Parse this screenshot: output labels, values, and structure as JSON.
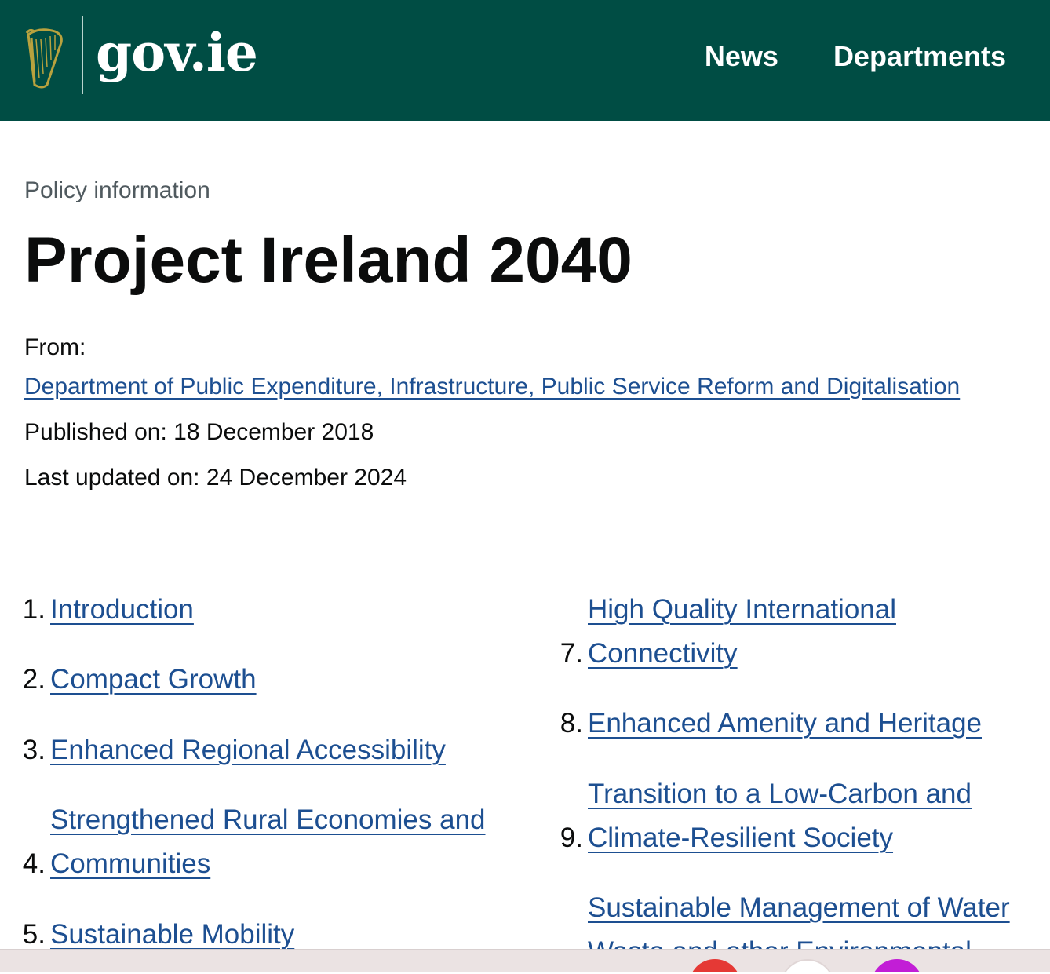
{
  "header": {
    "logo_text": "gov.ie",
    "nav": [
      "News",
      "Departments"
    ],
    "colors": {
      "background": "#004d44",
      "text": "#ffffff"
    }
  },
  "page": {
    "eyebrow": "Policy information",
    "title": "Project Ireland 2040",
    "from_label": "From:",
    "department": "Department of Public Expenditure, Infrastructure, Public Service Reform and Digitalisation",
    "published": "Published on: 18 December 2018",
    "updated": "Last updated on: 24 December 2024"
  },
  "toc": [
    {
      "num": "1.",
      "lines": [
        "Introduction"
      ]
    },
    {
      "num": "2.",
      "lines": [
        "Compact Growth"
      ]
    },
    {
      "num": "3.",
      "lines": [
        "Enhanced Regional Accessibility"
      ]
    },
    {
      "num": "4.",
      "lines": [
        "Strengthened Rural Economies and",
        "Communities"
      ]
    },
    {
      "num": "5.",
      "lines": [
        "Sustainable Mobility"
      ]
    },
    {
      "num": "7.",
      "lines": [
        "High Quality International",
        "Connectivity"
      ]
    },
    {
      "num": "8.",
      "lines": [
        "Enhanced Amenity and Heritage"
      ]
    },
    {
      "num": "9.",
      "lines": [
        "Transition to a Low-Carbon and",
        "Climate-Resilient Society"
      ]
    },
    {
      "num": "",
      "lines": [
        "Sustainable Management of Water",
        "Waste and other Environmental"
      ]
    }
  ],
  "colors": {
    "link": "#1d4f91",
    "text": "#0b0c0c",
    "muted": "#505a5f",
    "bottom_bar": "#ebe3e3"
  }
}
